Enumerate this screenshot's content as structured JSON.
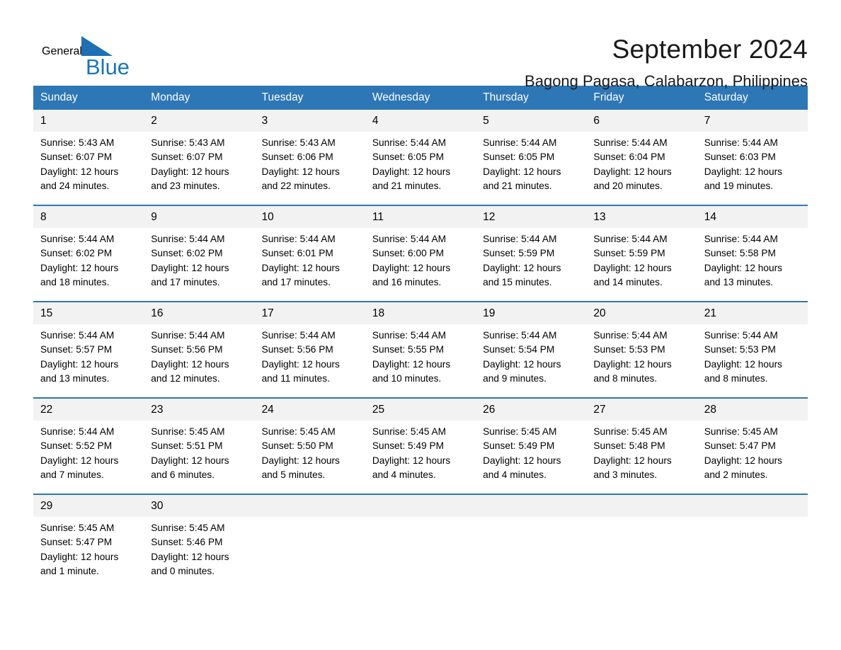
{
  "brand": {
    "name_part1": "General",
    "name_part2": "Blue",
    "logo_icon": "triangle-icon"
  },
  "header": {
    "title": "September 2024",
    "subtitle": "Bagong Pagasa, Calabarzon, Philippines"
  },
  "colors": {
    "header_blue": "#2e77b6",
    "brand_blue": "#1b75bb",
    "day_number_bg": "#f2f2f2",
    "text": "#000000"
  },
  "weekdays": [
    "Sunday",
    "Monday",
    "Tuesday",
    "Wednesday",
    "Thursday",
    "Friday",
    "Saturday"
  ],
  "weeks": [
    [
      {
        "day": "1",
        "sunrise": "Sunrise: 5:43 AM",
        "sunset": "Sunset: 6:07 PM",
        "daylight_line1": "Daylight: 12 hours",
        "daylight_line2": "and 24 minutes."
      },
      {
        "day": "2",
        "sunrise": "Sunrise: 5:43 AM",
        "sunset": "Sunset: 6:07 PM",
        "daylight_line1": "Daylight: 12 hours",
        "daylight_line2": "and 23 minutes."
      },
      {
        "day": "3",
        "sunrise": "Sunrise: 5:43 AM",
        "sunset": "Sunset: 6:06 PM",
        "daylight_line1": "Daylight: 12 hours",
        "daylight_line2": "and 22 minutes."
      },
      {
        "day": "4",
        "sunrise": "Sunrise: 5:44 AM",
        "sunset": "Sunset: 6:05 PM",
        "daylight_line1": "Daylight: 12 hours",
        "daylight_line2": "and 21 minutes."
      },
      {
        "day": "5",
        "sunrise": "Sunrise: 5:44 AM",
        "sunset": "Sunset: 6:05 PM",
        "daylight_line1": "Daylight: 12 hours",
        "daylight_line2": "and 21 minutes."
      },
      {
        "day": "6",
        "sunrise": "Sunrise: 5:44 AM",
        "sunset": "Sunset: 6:04 PM",
        "daylight_line1": "Daylight: 12 hours",
        "daylight_line2": "and 20 minutes."
      },
      {
        "day": "7",
        "sunrise": "Sunrise: 5:44 AM",
        "sunset": "Sunset: 6:03 PM",
        "daylight_line1": "Daylight: 12 hours",
        "daylight_line2": "and 19 minutes."
      }
    ],
    [
      {
        "day": "8",
        "sunrise": "Sunrise: 5:44 AM",
        "sunset": "Sunset: 6:02 PM",
        "daylight_line1": "Daylight: 12 hours",
        "daylight_line2": "and 18 minutes."
      },
      {
        "day": "9",
        "sunrise": "Sunrise: 5:44 AM",
        "sunset": "Sunset: 6:02 PM",
        "daylight_line1": "Daylight: 12 hours",
        "daylight_line2": "and 17 minutes."
      },
      {
        "day": "10",
        "sunrise": "Sunrise: 5:44 AM",
        "sunset": "Sunset: 6:01 PM",
        "daylight_line1": "Daylight: 12 hours",
        "daylight_line2": "and 17 minutes."
      },
      {
        "day": "11",
        "sunrise": "Sunrise: 5:44 AM",
        "sunset": "Sunset: 6:00 PM",
        "daylight_line1": "Daylight: 12 hours",
        "daylight_line2": "and 16 minutes."
      },
      {
        "day": "12",
        "sunrise": "Sunrise: 5:44 AM",
        "sunset": "Sunset: 5:59 PM",
        "daylight_line1": "Daylight: 12 hours",
        "daylight_line2": "and 15 minutes."
      },
      {
        "day": "13",
        "sunrise": "Sunrise: 5:44 AM",
        "sunset": "Sunset: 5:59 PM",
        "daylight_line1": "Daylight: 12 hours",
        "daylight_line2": "and 14 minutes."
      },
      {
        "day": "14",
        "sunrise": "Sunrise: 5:44 AM",
        "sunset": "Sunset: 5:58 PM",
        "daylight_line1": "Daylight: 12 hours",
        "daylight_line2": "and 13 minutes."
      }
    ],
    [
      {
        "day": "15",
        "sunrise": "Sunrise: 5:44 AM",
        "sunset": "Sunset: 5:57 PM",
        "daylight_line1": "Daylight: 12 hours",
        "daylight_line2": "and 13 minutes."
      },
      {
        "day": "16",
        "sunrise": "Sunrise: 5:44 AM",
        "sunset": "Sunset: 5:56 PM",
        "daylight_line1": "Daylight: 12 hours",
        "daylight_line2": "and 12 minutes."
      },
      {
        "day": "17",
        "sunrise": "Sunrise: 5:44 AM",
        "sunset": "Sunset: 5:56 PM",
        "daylight_line1": "Daylight: 12 hours",
        "daylight_line2": "and 11 minutes."
      },
      {
        "day": "18",
        "sunrise": "Sunrise: 5:44 AM",
        "sunset": "Sunset: 5:55 PM",
        "daylight_line1": "Daylight: 12 hours",
        "daylight_line2": "and 10 minutes."
      },
      {
        "day": "19",
        "sunrise": "Sunrise: 5:44 AM",
        "sunset": "Sunset: 5:54 PM",
        "daylight_line1": "Daylight: 12 hours",
        "daylight_line2": "and 9 minutes."
      },
      {
        "day": "20",
        "sunrise": "Sunrise: 5:44 AM",
        "sunset": "Sunset: 5:53 PM",
        "daylight_line1": "Daylight: 12 hours",
        "daylight_line2": "and 8 minutes."
      },
      {
        "day": "21",
        "sunrise": "Sunrise: 5:44 AM",
        "sunset": "Sunset: 5:53 PM",
        "daylight_line1": "Daylight: 12 hours",
        "daylight_line2": "and 8 minutes."
      }
    ],
    [
      {
        "day": "22",
        "sunrise": "Sunrise: 5:44 AM",
        "sunset": "Sunset: 5:52 PM",
        "daylight_line1": "Daylight: 12 hours",
        "daylight_line2": "and 7 minutes."
      },
      {
        "day": "23",
        "sunrise": "Sunrise: 5:45 AM",
        "sunset": "Sunset: 5:51 PM",
        "daylight_line1": "Daylight: 12 hours",
        "daylight_line2": "and 6 minutes."
      },
      {
        "day": "24",
        "sunrise": "Sunrise: 5:45 AM",
        "sunset": "Sunset: 5:50 PM",
        "daylight_line1": "Daylight: 12 hours",
        "daylight_line2": "and 5 minutes."
      },
      {
        "day": "25",
        "sunrise": "Sunrise: 5:45 AM",
        "sunset": "Sunset: 5:49 PM",
        "daylight_line1": "Daylight: 12 hours",
        "daylight_line2": "and 4 minutes."
      },
      {
        "day": "26",
        "sunrise": "Sunrise: 5:45 AM",
        "sunset": "Sunset: 5:49 PM",
        "daylight_line1": "Daylight: 12 hours",
        "daylight_line2": "and 4 minutes."
      },
      {
        "day": "27",
        "sunrise": "Sunrise: 5:45 AM",
        "sunset": "Sunset: 5:48 PM",
        "daylight_line1": "Daylight: 12 hours",
        "daylight_line2": "and 3 minutes."
      },
      {
        "day": "28",
        "sunrise": "Sunrise: 5:45 AM",
        "sunset": "Sunset: 5:47 PM",
        "daylight_line1": "Daylight: 12 hours",
        "daylight_line2": "and 2 minutes."
      }
    ],
    [
      {
        "day": "29",
        "sunrise": "Sunrise: 5:45 AM",
        "sunset": "Sunset: 5:47 PM",
        "daylight_line1": "Daylight: 12 hours",
        "daylight_line2": "and 1 minute."
      },
      {
        "day": "30",
        "sunrise": "Sunrise: 5:45 AM",
        "sunset": "Sunset: 5:46 PM",
        "daylight_line1": "Daylight: 12 hours",
        "daylight_line2": "and 0 minutes."
      },
      {
        "day": "",
        "sunrise": "",
        "sunset": "",
        "daylight_line1": "",
        "daylight_line2": ""
      },
      {
        "day": "",
        "sunrise": "",
        "sunset": "",
        "daylight_line1": "",
        "daylight_line2": ""
      },
      {
        "day": "",
        "sunrise": "",
        "sunset": "",
        "daylight_line1": "",
        "daylight_line2": ""
      },
      {
        "day": "",
        "sunrise": "",
        "sunset": "",
        "daylight_line1": "",
        "daylight_line2": ""
      },
      {
        "day": "",
        "sunrise": "",
        "sunset": "",
        "daylight_line1": "",
        "daylight_line2": ""
      }
    ]
  ]
}
